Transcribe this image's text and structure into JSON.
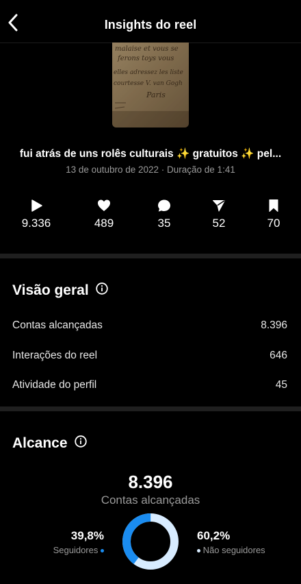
{
  "header": {
    "title": "Insights do reel",
    "back_icon": "chevron-left-icon"
  },
  "reel": {
    "thumbnail_script": [
      "malaise et vous se",
      "ferons toys vous",
      "elles adressez les liste",
      "courtesse V. van Gogh",
      "Paris"
    ],
    "caption": "fui atrás de uns rolês culturais ✨ gratuitos ✨ pel...",
    "date": "13 de outubro de 2022",
    "separator": " · ",
    "duration": "Duração de 1:41"
  },
  "stats": [
    {
      "icon": "play-icon",
      "value": "9.336"
    },
    {
      "icon": "heart-icon",
      "value": "489"
    },
    {
      "icon": "comment-icon",
      "value": "35"
    },
    {
      "icon": "send-icon",
      "value": "52"
    },
    {
      "icon": "bookmark-icon",
      "value": "70"
    }
  ],
  "overview": {
    "title": "Visão geral",
    "rows": [
      {
        "label": "Contas alcançadas",
        "value": "8.396"
      },
      {
        "label": "Interações do reel",
        "value": "646"
      },
      {
        "label": "Atividade do perfil",
        "value": "45"
      }
    ]
  },
  "reach": {
    "title": "Alcance",
    "total": "8.396",
    "total_label": "Contas alcançadas",
    "followers_pct": "39,8%",
    "followers_label": "Seguidores",
    "followers_fraction": 0.398,
    "nonfollowers_pct": "60,2%",
    "nonfollowers_label": "Não seguidores",
    "colors": {
      "followers": "#1a8cf0",
      "nonfollowers": "#d8ecff"
    }
  }
}
